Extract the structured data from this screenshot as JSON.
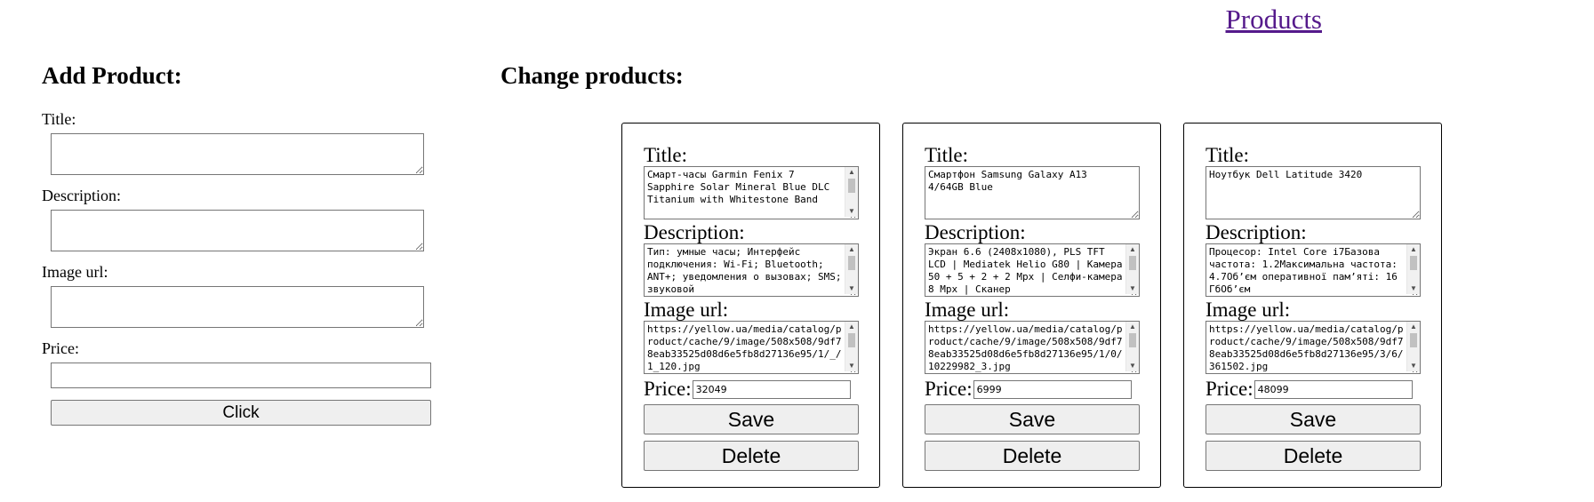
{
  "header": {
    "products_link": "Products"
  },
  "add_product": {
    "heading": "Add Product:",
    "title_label": "Title:",
    "description_label": "Description:",
    "image_label": "Image url:",
    "price_label": "Price:",
    "submit_label": "Click"
  },
  "change_products": {
    "heading": "Change products:",
    "labels": {
      "title": "Title:",
      "description": "Description:",
      "image": "Image url:",
      "price": "Price:",
      "save": "Save",
      "delete": "Delete"
    },
    "items": [
      {
        "title": "Смарт-часы Garmin Fenix 7 Sapphire Solar Mineral Blue DLC Titanium with Whitestone Band",
        "description": "Тип: умные часы; Интерфейс подключения: Wi-Fi; Bluetooth; ANT+; уведомления о вызовах; SMS; звуковой",
        "image": "https://yellow.ua/media/catalog/product/cache/9/image/508x508/9df78eab33525d08d6e5fb8d27136e95/1/_/1_120.jpg",
        "price": "32049"
      },
      {
        "title": "Смартфон Samsung Galaxy A13 4/64GB Blue",
        "description": "Экран 6.6 (2408x1080), PLS TFT LCD | Mediatek Helio G80 | Камера 50 + 5 + 2 + 2 Мрх | Селфи-камера 8 Мрх | Сканер",
        "image": "https://yellow.ua/media/catalog/product/cache/9/image/508x508/9df78eab33525d08d6e5fb8d27136e95/1/0/10229982_3.jpg",
        "price": "6999"
      },
      {
        "title": "Ноутбук Dell Latitude 3420",
        "description": "Процесор: Intel Core i7Базова частота: 1.2Максимальна частота: 4.7Об’єм оперативної пам’яті: 16 ГбОб’єм",
        "image": "https://yellow.ua/media/catalog/product/cache/9/image/508x508/9df78eab33525d08d6e5fb8d27136e95/3/6/361502.jpg",
        "price": "48099"
      }
    ]
  }
}
